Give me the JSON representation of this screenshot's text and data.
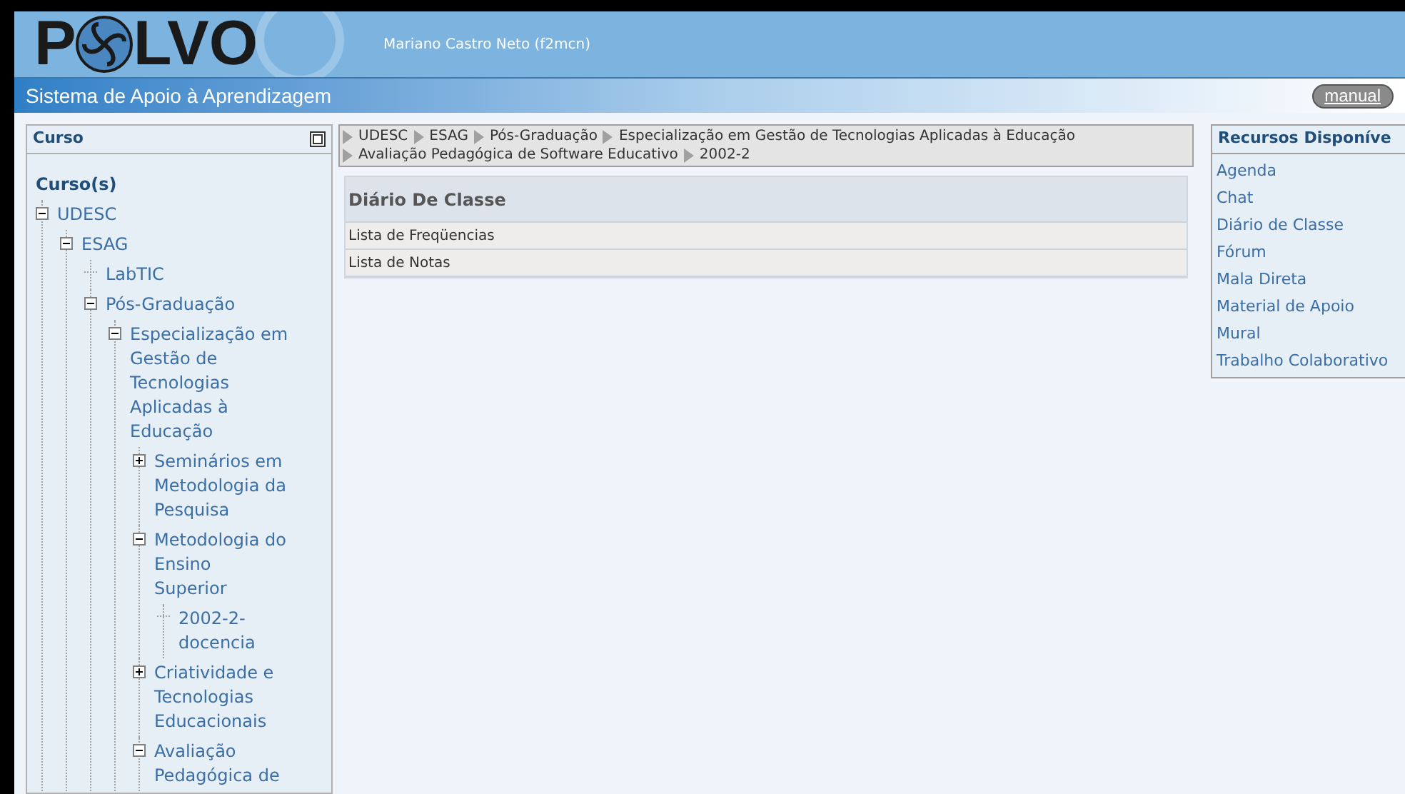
{
  "header": {
    "logo": {
      "before": "P",
      "after": "LVO"
    },
    "user": "Mariano Castro Neto (f2mcn)",
    "subtitle": "Sistema de Apoio à Aprendizagem",
    "manual_button": "manual"
  },
  "sidebar": {
    "title": "Curso",
    "heading": "Curso(s)",
    "tree": [
      {
        "label": "UDESC",
        "kind": "folder",
        "expanded": true,
        "children": [
          {
            "label": "ESAG",
            "kind": "folder",
            "expanded": true,
            "children": [
              {
                "label": "LabTIC",
                "kind": "leaf"
              },
              {
                "label": "Pós-Graduação",
                "kind": "folder",
                "expanded": true,
                "children": [
                  {
                    "label": "Especialização em Gestão de Tecnologias Aplicadas à Educação",
                    "kind": "folder",
                    "expanded": true,
                    "children": [
                      {
                        "label": "Seminários em Metodologia da Pesquisa",
                        "kind": "folder",
                        "expanded": false
                      },
                      {
                        "label": "Metodologia do Ensino Superior",
                        "kind": "folder",
                        "expanded": true,
                        "children": [
                          {
                            "label": "2002-2-docencia",
                            "kind": "leaf"
                          }
                        ]
                      },
                      {
                        "label": "Criatividade e Tecnologias Educacionais",
                        "kind": "folder",
                        "expanded": false
                      },
                      {
                        "label": "Avaliação Pedagógica de",
                        "kind": "folder",
                        "expanded": true
                      }
                    ]
                  }
                ]
              }
            ]
          }
        ]
      }
    ]
  },
  "breadcrumb": [
    "UDESC",
    "ESAG",
    "Pós-Graduação",
    "Especialização em Gestão de Tecnologias Aplicadas à Educação",
    "Avaliação Pedagógica de Software Educativo",
    "2002-2"
  ],
  "panel": {
    "title": "Diário De Classe",
    "rows": [
      "Lista de Freqüencias",
      "Lista de Notas"
    ]
  },
  "resources": {
    "title": "Recursos Disponíve",
    "items": [
      "Agenda",
      "Chat",
      "Diário de Classe",
      "Fórum",
      "Mala Direta",
      "Material de Apoio",
      "Mural",
      "Trabalho Colaborativo"
    ]
  }
}
